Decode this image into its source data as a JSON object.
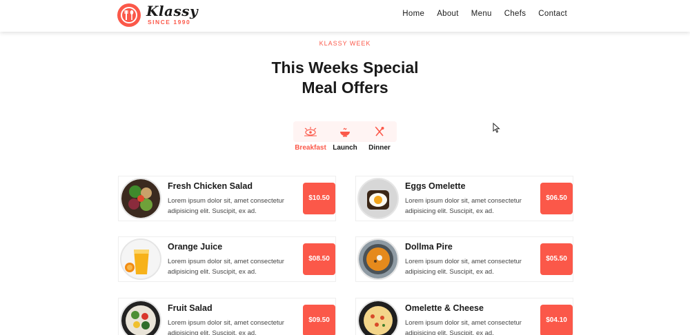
{
  "brand": {
    "name": "Klassy",
    "tagline": "SINCE 1990",
    "accent": "#fb5849"
  },
  "nav": [
    "Home",
    "About",
    "Menu",
    "Chefs",
    "Contact"
  ],
  "section": {
    "eyebrow": "KLASSY WEEK",
    "title_line1": "This Weeks Special",
    "title_line2": "Meal Offers"
  },
  "tabs": [
    {
      "label": "Breakfast",
      "icon": "breakfast-icon",
      "active": true
    },
    {
      "label": "Launch",
      "icon": "lunch-bowl-icon",
      "active": false
    },
    {
      "label": "Dinner",
      "icon": "dinner-cutlery-icon",
      "active": false
    }
  ],
  "menu": {
    "left": [
      {
        "name": "Fresh Chicken Salad",
        "desc": "Lorem ipsum dolor sit, amet consectetur adipisicing elit. Suscipit, ex ad.",
        "price": "$10.50"
      },
      {
        "name": "Orange Juice",
        "desc": "Lorem ipsum dolor sit, amet consectetur adipisicing elit. Suscipit, ex ad.",
        "price": "$08.50"
      },
      {
        "name": "Fruit Salad",
        "desc": "Lorem ipsum dolor sit, amet consectetur adipisicing elit. Suscipit, ex ad.",
        "price": "$09.50"
      }
    ],
    "right": [
      {
        "name": "Eggs Omelette",
        "desc": "Lorem ipsum dolor sit, amet consectetur adipisicing elit. Suscipit, ex ad.",
        "price": "$06.50"
      },
      {
        "name": "Dollma Pire",
        "desc": "Lorem ipsum dolor sit, amet consectetur adipisicing elit. Suscipit, ex ad.",
        "price": "$05.50"
      },
      {
        "name": "Omelette & Cheese",
        "desc": "Lorem ipsum dolor sit, amet consectetur adipisicing elit. Suscipit, ex ad.",
        "price": "$04.10"
      }
    ]
  }
}
